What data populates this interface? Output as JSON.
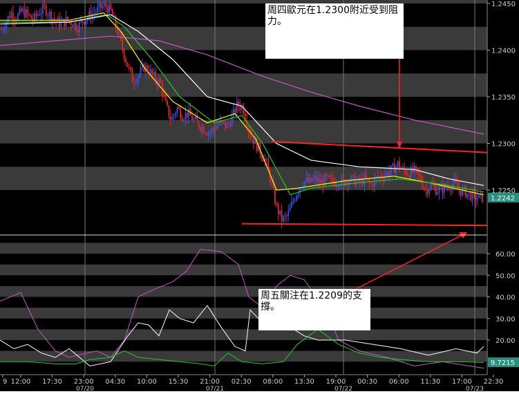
{
  "chart_data": [
    {
      "type": "candlestick",
      "pair": "EUR/USD",
      "ylim": [
        1.22,
        1.246
      ],
      "y_ticks": [
        "1.2450",
        "1.2400",
        "1.2350",
        "1.2300",
        "1.2250"
      ],
      "last_price_label": "1.2242",
      "x_tick_labels": [
        "9",
        "12:00",
        "17:30",
        "23:00",
        "04:30",
        "10:00",
        "15:30",
        "21:00",
        "02:30",
        "08:00",
        "13:30",
        "19:00",
        "00:30",
        "06:00",
        "11:30",
        "17:00",
        "22:30"
      ],
      "date_labels": [
        "07/20",
        "07/21",
        "07/22",
        "07/23"
      ],
      "price_path": [
        [
          0,
          1.242
        ],
        [
          8,
          1.243
        ],
        [
          16,
          1.244
        ],
        [
          24,
          1.2435
        ],
        [
          32,
          1.2442
        ],
        [
          40,
          1.2438
        ],
        [
          48,
          1.2432
        ],
        [
          56,
          1.244
        ],
        [
          64,
          1.2445
        ],
        [
          72,
          1.2438
        ],
        [
          80,
          1.2432
        ],
        [
          88,
          1.2428
        ],
        [
          96,
          1.2432
        ],
        [
          104,
          1.243
        ],
        [
          112,
          1.2425
        ],
        [
          120,
          1.2432
        ],
        [
          128,
          1.2436
        ],
        [
          136,
          1.244
        ],
        [
          144,
          1.2445
        ],
        [
          152,
          1.2448
        ],
        [
          160,
          1.2442
        ],
        [
          168,
          1.2425
        ],
        [
          176,
          1.2405
        ],
        [
          184,
          1.2385
        ],
        [
          192,
          1.2368
        ],
        [
          200,
          1.2372
        ],
        [
          208,
          1.2382
        ],
        [
          216,
          1.2378
        ],
        [
          224,
          1.237
        ],
        [
          232,
          1.2365
        ],
        [
          240,
          1.234
        ],
        [
          248,
          1.2325
        ],
        [
          256,
          1.2338
        ],
        [
          264,
          1.233
        ],
        [
          272,
          1.2332
        ],
        [
          280,
          1.2325
        ],
        [
          288,
          1.232
        ],
        [
          296,
          1.2315
        ],
        [
          304,
          1.2312
        ],
        [
          312,
          1.2318
        ],
        [
          320,
          1.2322
        ],
        [
          328,
          1.2318
        ],
        [
          336,
          1.2328
        ],
        [
          344,
          1.2342
        ],
        [
          352,
          1.2338
        ],
        [
          360,
          1.2315
        ],
        [
          368,
          1.2302
        ],
        [
          376,
          1.2292
        ],
        [
          384,
          1.2282
        ],
        [
          392,
          1.226
        ],
        [
          400,
          1.2232
        ],
        [
          408,
          1.2218
        ],
        [
          416,
          1.2222
        ],
        [
          424,
          1.2238
        ],
        [
          432,
          1.2252
        ],
        [
          440,
          1.226
        ],
        [
          448,
          1.2258
        ],
        [
          456,
          1.2262
        ],
        [
          464,
          1.2258
        ],
        [
          472,
          1.2262
        ],
        [
          480,
          1.2258
        ],
        [
          488,
          1.226
        ],
        [
          496,
          1.2258
        ],
        [
          504,
          1.2262
        ],
        [
          512,
          1.226
        ],
        [
          520,
          1.2258
        ],
        [
          528,
          1.2262
        ],
        [
          536,
          1.2255
        ],
        [
          544,
          1.2262
        ],
        [
          552,
          1.2265
        ],
        [
          560,
          1.2268
        ],
        [
          568,
          1.2272
        ],
        [
          576,
          1.2278
        ],
        [
          584,
          1.227
        ],
        [
          592,
          1.2268
        ],
        [
          600,
          1.227
        ],
        [
          608,
          1.2262
        ],
        [
          616,
          1.225
        ],
        [
          624,
          1.2255
        ],
        [
          632,
          1.225
        ],
        [
          640,
          1.2252
        ],
        [
          648,
          1.2255
        ],
        [
          656,
          1.2258
        ],
        [
          664,
          1.225
        ],
        [
          672,
          1.2248
        ],
        [
          680,
          1.2245
        ],
        [
          688,
          1.2242
        ],
        [
          696,
          1.2242
        ]
      ],
      "moving_averages": [
        {
          "color": "#ffff00",
          "path": [
            [
              0,
              1.2432
            ],
            [
              100,
              1.2432
            ],
            [
              150,
              1.244
            ],
            [
              175,
              1.242
            ],
            [
              210,
              1.238
            ],
            [
              250,
              1.2345
            ],
            [
              300,
              1.2322
            ],
            [
              340,
              1.2332
            ],
            [
              370,
              1.2305
            ],
            [
              400,
              1.225
            ],
            [
              430,
              1.2252
            ],
            [
              500,
              1.226
            ],
            [
              570,
              1.2265
            ],
            [
              620,
              1.2258
            ],
            [
              700,
              1.2245
            ]
          ]
        },
        {
          "color": "#22cc22",
          "path": [
            [
              0,
              1.243
            ],
            [
              100,
              1.243
            ],
            [
              155,
              1.2438
            ],
            [
              180,
              1.2425
            ],
            [
              220,
              1.239
            ],
            [
              260,
              1.235
            ],
            [
              310,
              1.2322
            ],
            [
              350,
              1.233
            ],
            [
              380,
              1.23
            ],
            [
              420,
              1.2245
            ],
            [
              450,
              1.2252
            ],
            [
              520,
              1.2258
            ],
            [
              580,
              1.2262
            ],
            [
              640,
              1.2256
            ],
            [
              700,
              1.2248
            ]
          ]
        },
        {
          "color": "#ffffff",
          "path": [
            [
              0,
              1.2428
            ],
            [
              100,
              1.243
            ],
            [
              160,
              1.2438
            ],
            [
              200,
              1.242
            ],
            [
              250,
              1.239
            ],
            [
              300,
              1.235
            ],
            [
              350,
              1.234
            ],
            [
              400,
              1.23
            ],
            [
              450,
              1.2282
            ],
            [
              520,
              1.2275
            ],
            [
              600,
              1.2272
            ],
            [
              650,
              1.2262
            ],
            [
              700,
              1.2255
            ]
          ]
        },
        {
          "color": "#cc55cc",
          "path": [
            [
              0,
              1.2405
            ],
            [
              80,
              1.241
            ],
            [
              160,
              1.2415
            ],
            [
              230,
              1.241
            ],
            [
              300,
              1.2395
            ],
            [
              380,
              1.2372
            ],
            [
              450,
              1.2355
            ],
            [
              520,
              1.234
            ],
            [
              600,
              1.2325
            ],
            [
              700,
              1.231
            ]
          ]
        }
      ],
      "trendlines": [
        {
          "color": "#ff2222",
          "from": [
            393,
            1.2302
          ],
          "to": [
            712,
            1.229
          ]
        },
        {
          "color": "#ff2222",
          "from": [
            350,
            1.2214
          ],
          "to": [
            716,
            1.2212
          ]
        }
      ],
      "annotations": [
        {
          "text": "周四歐元在1.2300附近受到阻力。"
        }
      ]
    },
    {
      "type": "line",
      "ylim": [
        0,
        70
      ],
      "y_ticks": [
        "60.00",
        "50.00",
        "40.00",
        "30.00",
        "20.00"
      ],
      "last_value_label": "9.7215",
      "series": [
        {
          "color": "#cc55cc",
          "path": [
            [
              0,
              38
            ],
            [
              30,
              42
            ],
            [
              55,
              25
            ],
            [
              80,
              15
            ],
            [
              100,
              12
            ],
            [
              140,
              15
            ],
            [
              160,
              12
            ],
            [
              180,
              20
            ],
            [
              200,
              40
            ],
            [
              220,
              43
            ],
            [
              250,
              47
            ],
            [
              270,
              52
            ],
            [
              290,
              62
            ],
            [
              320,
              61
            ],
            [
              345,
              55
            ],
            [
              360,
              40
            ],
            [
              380,
              35
            ],
            [
              400,
              45
            ],
            [
              420,
              50
            ],
            [
              440,
              48
            ],
            [
              470,
              35
            ],
            [
              490,
              20
            ],
            [
              520,
              15
            ],
            [
              560,
              12
            ],
            [
              600,
              8
            ],
            [
              640,
              10
            ],
            [
              680,
              8
            ],
            [
              700,
              7
            ]
          ]
        },
        {
          "color": "#ffffff",
          "path": [
            [
              0,
              20
            ],
            [
              20,
              16
            ],
            [
              40,
              18
            ],
            [
              60,
              14
            ],
            [
              80,
              12
            ],
            [
              100,
              16
            ],
            [
              130,
              8
            ],
            [
              160,
              10
            ],
            [
              185,
              22
            ],
            [
              200,
              28
            ],
            [
              215,
              27
            ],
            [
              230,
              22
            ],
            [
              245,
              34
            ],
            [
              260,
              30
            ],
            [
              280,
              28
            ],
            [
              300,
              36
            ],
            [
              320,
              26
            ],
            [
              340,
              17
            ],
            [
              355,
              15
            ],
            [
              362,
              34
            ],
            [
              380,
              28
            ],
            [
              400,
              28
            ],
            [
              420,
              26
            ],
            [
              440,
              22
            ],
            [
              460,
              20
            ],
            [
              500,
              20
            ],
            [
              540,
              18
            ],
            [
              580,
              16
            ],
            [
              620,
              13
            ],
            [
              660,
              16
            ],
            [
              690,
              14
            ],
            [
              700,
              17
            ]
          ]
        },
        {
          "color": "#22cc22",
          "path": [
            [
              0,
              10
            ],
            [
              40,
              10
            ],
            [
              80,
              9
            ],
            [
              110,
              9
            ],
            [
              130,
              11
            ],
            [
              160,
              12
            ],
            [
              180,
              15
            ],
            [
              200,
              12
            ],
            [
              230,
              11
            ],
            [
              260,
              10
            ],
            [
              290,
              9
            ],
            [
              310,
              8
            ],
            [
              330,
              14
            ],
            [
              350,
              10
            ],
            [
              380,
              9
            ],
            [
              410,
              10
            ],
            [
              430,
              18
            ],
            [
              460,
              25
            ],
            [
              490,
              18
            ],
            [
              520,
              14
            ],
            [
              550,
              12
            ],
            [
              580,
              11
            ],
            [
              620,
              10
            ],
            [
              660,
              10
            ],
            [
              700,
              9.7
            ]
          ]
        }
      ],
      "annotations": [
        {
          "text": "周五關注在1.2209的支撐。"
        }
      ]
    }
  ]
}
